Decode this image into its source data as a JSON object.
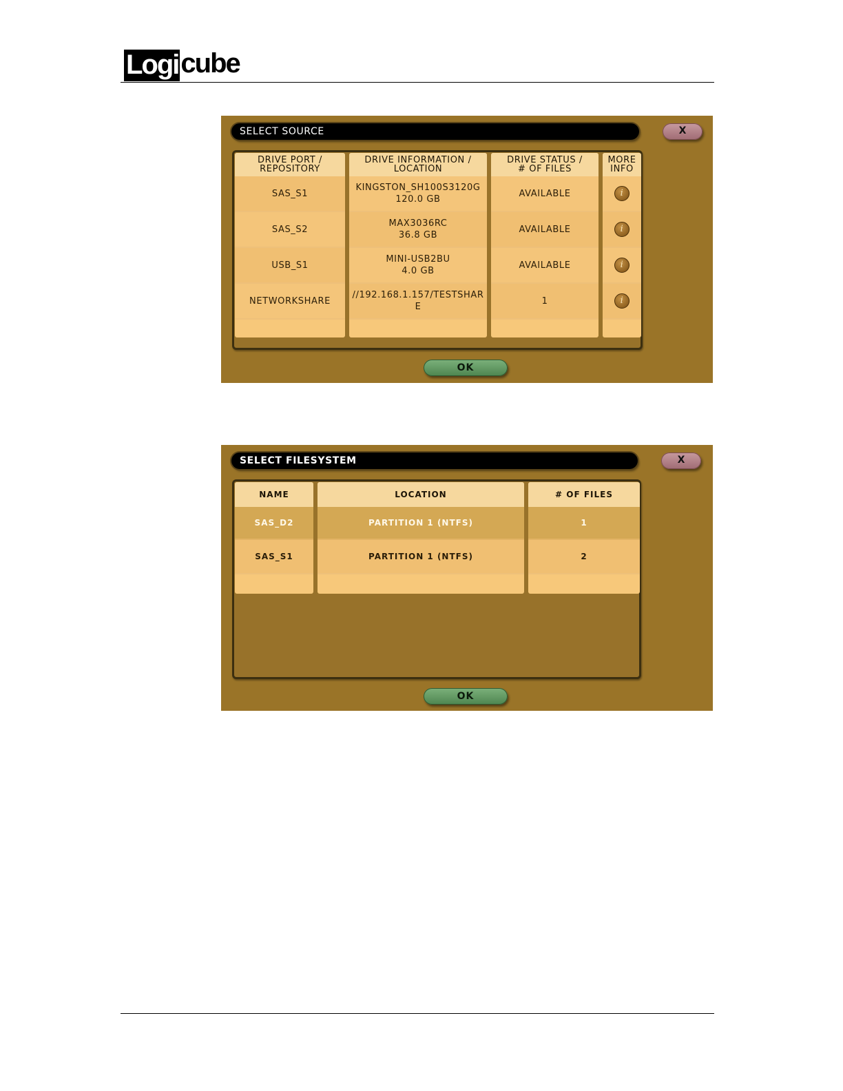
{
  "logo": {
    "boxed": "Logi",
    "rest": "cube"
  },
  "select_source": {
    "title": "SELECT SOURCE",
    "close_label": "X",
    "ok_label": "OK",
    "columns": [
      [
        "DRIVE PORT /",
        "REPOSITORY"
      ],
      [
        "DRIVE INFORMATION /",
        "LOCATION"
      ],
      [
        "DRIVE STATUS /",
        "# OF FILES"
      ],
      [
        "MORE",
        "INFO"
      ]
    ],
    "rows": [
      {
        "port": "SAS_S1",
        "info": [
          "KINGSTON_SH100S3120G",
          "120.0 GB"
        ],
        "status": "AVAILABLE",
        "more": "i"
      },
      {
        "port": "SAS_S2",
        "info": [
          "MAX3036RC",
          "36.8 GB"
        ],
        "status": "AVAILABLE",
        "more": "i"
      },
      {
        "port": "USB_S1",
        "info": [
          "MINI-USB2BU",
          "4.0 GB"
        ],
        "status": "AVAILABLE",
        "more": "i"
      },
      {
        "port": "NETWORKSHARE",
        "info": [
          "//192.168.1.157/TESTSHAR",
          "E"
        ],
        "status": "1",
        "more": "i"
      }
    ]
  },
  "select_filesystem": {
    "title": "SELECT FILESYSTEM",
    "close_label": "X",
    "ok_label": "OK",
    "columns": [
      "NAME",
      "LOCATION",
      "# OF FILES"
    ],
    "rows": [
      {
        "name": "SAS_D2",
        "location": "PARTITION 1 (NTFS)",
        "files": "1",
        "selected": true
      },
      {
        "name": "SAS_S1",
        "location": "PARTITION 1 (NTFS)",
        "files": "2",
        "selected": false
      }
    ]
  }
}
